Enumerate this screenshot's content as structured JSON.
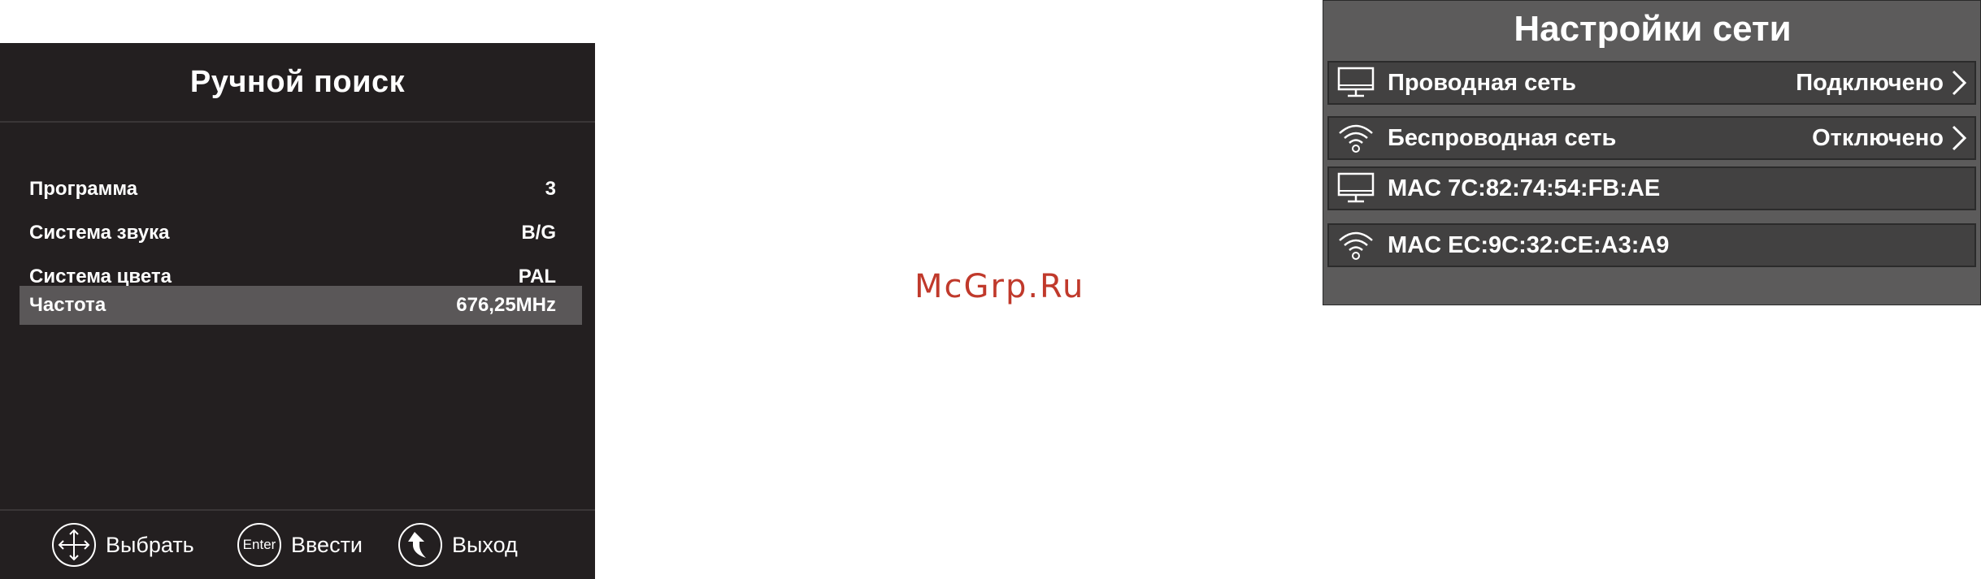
{
  "manual_search": {
    "title": "Ручной поиск",
    "rows": [
      {
        "label": "Программа",
        "value": "3"
      },
      {
        "label": "Система звука",
        "value": "B/G"
      },
      {
        "label": "Система цвета",
        "value": "PAL"
      },
      {
        "label": "Частота",
        "value": "676,25MHz"
      }
    ],
    "hints": {
      "select_label": "Выбрать",
      "enter_icon_text": "Enter",
      "enter_label": "Ввести",
      "exit_label": "Выход"
    }
  },
  "watermark": "McGrp.Ru",
  "network_settings": {
    "title": "Настройки сети",
    "rows": [
      {
        "icon": "monitor-icon",
        "label": "Проводная сеть",
        "status": "Подключено"
      },
      {
        "icon": "wifi-icon",
        "label": "Беспроводная сеть",
        "status": "Отключено"
      },
      {
        "icon": "monitor-icon",
        "label": "MAC 7C:82:74:54:FB:AE"
      },
      {
        "icon": "wifi-icon",
        "label": "MAC EC:9C:32:CE:A3:A9"
      }
    ]
  }
}
